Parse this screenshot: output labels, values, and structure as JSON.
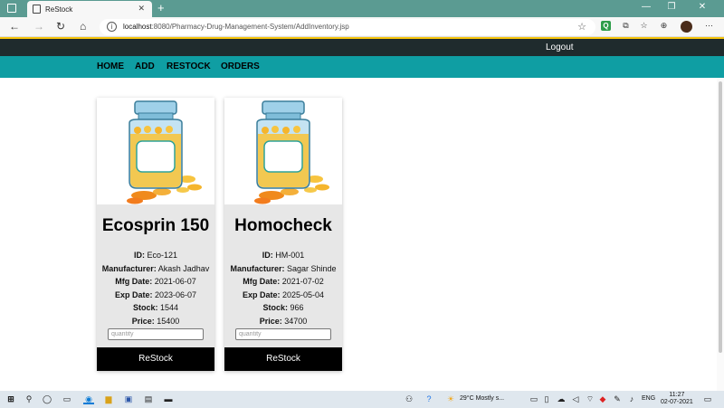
{
  "browser": {
    "tab_title": "ReStock",
    "url_host": "localhost",
    "url_rest": ":8080/Pharmacy-Drug-Management-System/AddInventory.jsp"
  },
  "header": {
    "logout_label": "Logout",
    "nav": [
      "HOME",
      "ADD",
      "RESTOCK",
      "ORDERS"
    ]
  },
  "labels": {
    "id": "ID:",
    "manufacturer": "Manufacturer:",
    "mfg_date": "Mfg Date:",
    "exp_date": "Exp Date:",
    "stock": "Stock:",
    "price": "Price:"
  },
  "cards": [
    {
      "name": "Ecosprin 150",
      "id": "Eco-121",
      "manufacturer": "Akash Jadhav",
      "mfg_date": "2021-06-07",
      "exp_date": "2023-06-07",
      "stock": "1544",
      "price": "15400",
      "qty_placeholder": "quantity",
      "button_label": "ReStock"
    },
    {
      "name": "Homocheck",
      "id": "HM-001",
      "manufacturer": "Sagar Shinde",
      "mfg_date": "2021-07-02",
      "exp_date": "2025-05-04",
      "stock": "966",
      "price": "34700",
      "qty_placeholder": "quantity",
      "button_label": "ReStock"
    }
  ],
  "taskbar": {
    "weather": "29°C  Mostly s...",
    "lang": "ENG",
    "time": "11:27",
    "date": "02-07-2021"
  },
  "colors": {
    "navbar": "#0f9ea3",
    "topstrip": "#1f2b2d",
    "accent_line": "#f6c40c",
    "button": "#000000"
  }
}
